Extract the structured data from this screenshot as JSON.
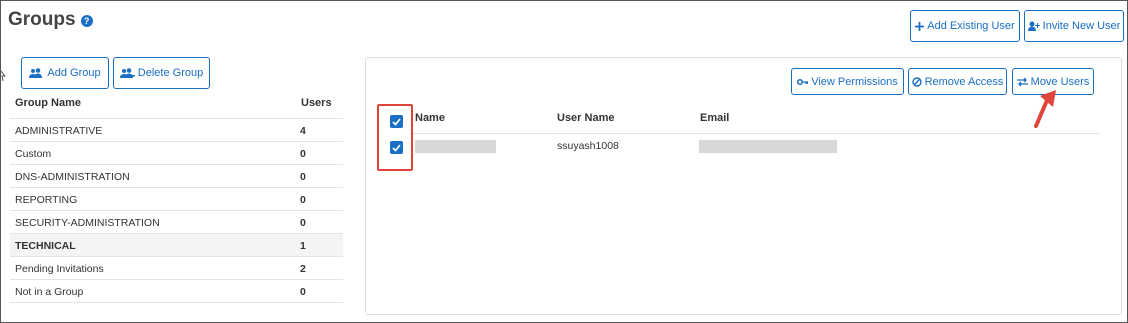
{
  "header": {
    "title": "Groups"
  },
  "top_actions": {
    "add_existing_user": "Add Existing User",
    "invite_new_user": "Invite New User"
  },
  "group_actions": {
    "add_group": "Add Group",
    "delete_group": "Delete Group"
  },
  "groups_table": {
    "col_name": "Group Name",
    "col_users": "Users",
    "rows": [
      {
        "name": "ADMINISTRATIVE",
        "users": "4"
      },
      {
        "name": "Custom",
        "users": "0"
      },
      {
        "name": "DNS-ADMINISTRATION",
        "users": "0"
      },
      {
        "name": "REPORTING",
        "users": "0"
      },
      {
        "name": "SECURITY-ADMINISTRATION",
        "users": "0"
      },
      {
        "name": "TECHNICAL",
        "users": "1",
        "selected": true
      },
      {
        "name": "Pending Invitations",
        "users": "2"
      },
      {
        "name": "Not in a Group",
        "users": "0"
      }
    ]
  },
  "user_actions": {
    "view_permissions": "View Permissions",
    "remove_access": "Remove Access",
    "move_users": "Move Users"
  },
  "users_table": {
    "col_name": "Name",
    "col_username": "User Name",
    "col_email": "Email",
    "rows": [
      {
        "name": "",
        "username": "ssuyash1008",
        "email": ""
      }
    ]
  },
  "colors": {
    "accent": "#1a6fc4",
    "highlight": "#e0453c"
  }
}
